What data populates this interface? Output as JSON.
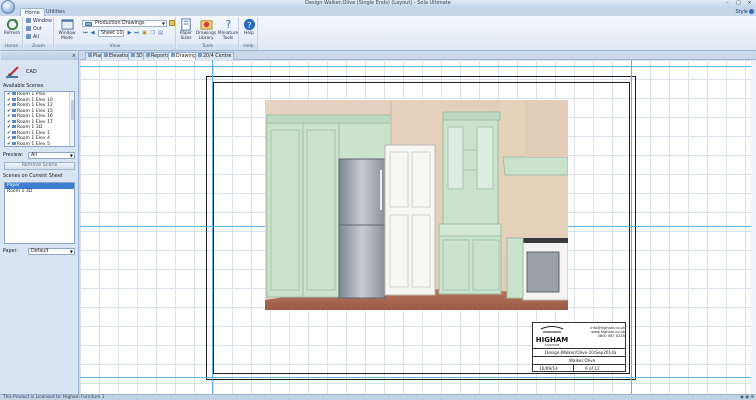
{
  "window": {
    "title": "Design Walker,Olive (Single Ends) (Layout) - Sola Ultimate"
  },
  "ribbon_tabs": {
    "home": "Home",
    "utilities": "Utilities",
    "style": "Style"
  },
  "ribbon": {
    "groups": {
      "home": "Home",
      "zoom": "Zoom",
      "view": "View",
      "tools": "Tools",
      "help": "Help"
    },
    "refresh": "Refresh",
    "zoom_window": "Window",
    "zoom_out": "Out",
    "zoom_all": "All",
    "window_mode": "Window Mode",
    "view_combo": "Production Drawings",
    "sheet_combo": "Sheet 10",
    "paper_sizes": "Paper Sizes",
    "drawings_library": "Drawings Library",
    "miniature_tools": "Miniature Tools",
    "help": "Help"
  },
  "left_panel": {
    "header": "",
    "cad_label": "CAD",
    "available_scenes_label": "Available Scenes",
    "scenes": [
      "Room 1 Plan",
      "Room 1 Elev 10",
      "Room 1 Elev 12",
      "Room 1 Elev 15",
      "Room 1 Elev 16",
      "Room 1 Elev 17",
      "Room 1 3D",
      "Room 1 Elev 1",
      "Room 1 Elev 4",
      "Room 1 Elev 5"
    ],
    "preview_label": "Preview:",
    "preview_value": "All",
    "remove_scene": "Remove Scene",
    "scenes_on_sheet_label": "Scenes on Current Sheet",
    "sheet_scenes": [
      "Paper",
      "Room 1 3D"
    ],
    "paper_label": "Paper:",
    "paper_value": "Default"
  },
  "doc_tabs": [
    "Plan",
    "Elevation",
    "3D",
    "Reports",
    "Drawings",
    "20/4 Centre"
  ],
  "title_block": {
    "logo_text": "HIGHAM",
    "logo_sub": "FURNITURE",
    "email": "info@higham.co.uk",
    "web": "www.higham.co.uk",
    "phone": "0800 587 0235",
    "design_ref": "Design-Walker/Olive-10/Sep2014a",
    "name": "Walker,Olive",
    "date": "10/09/14",
    "sheet": "9 of 12"
  },
  "status_bar": {
    "text": "This Product is Licensed to: Higham Furniture 1"
  }
}
